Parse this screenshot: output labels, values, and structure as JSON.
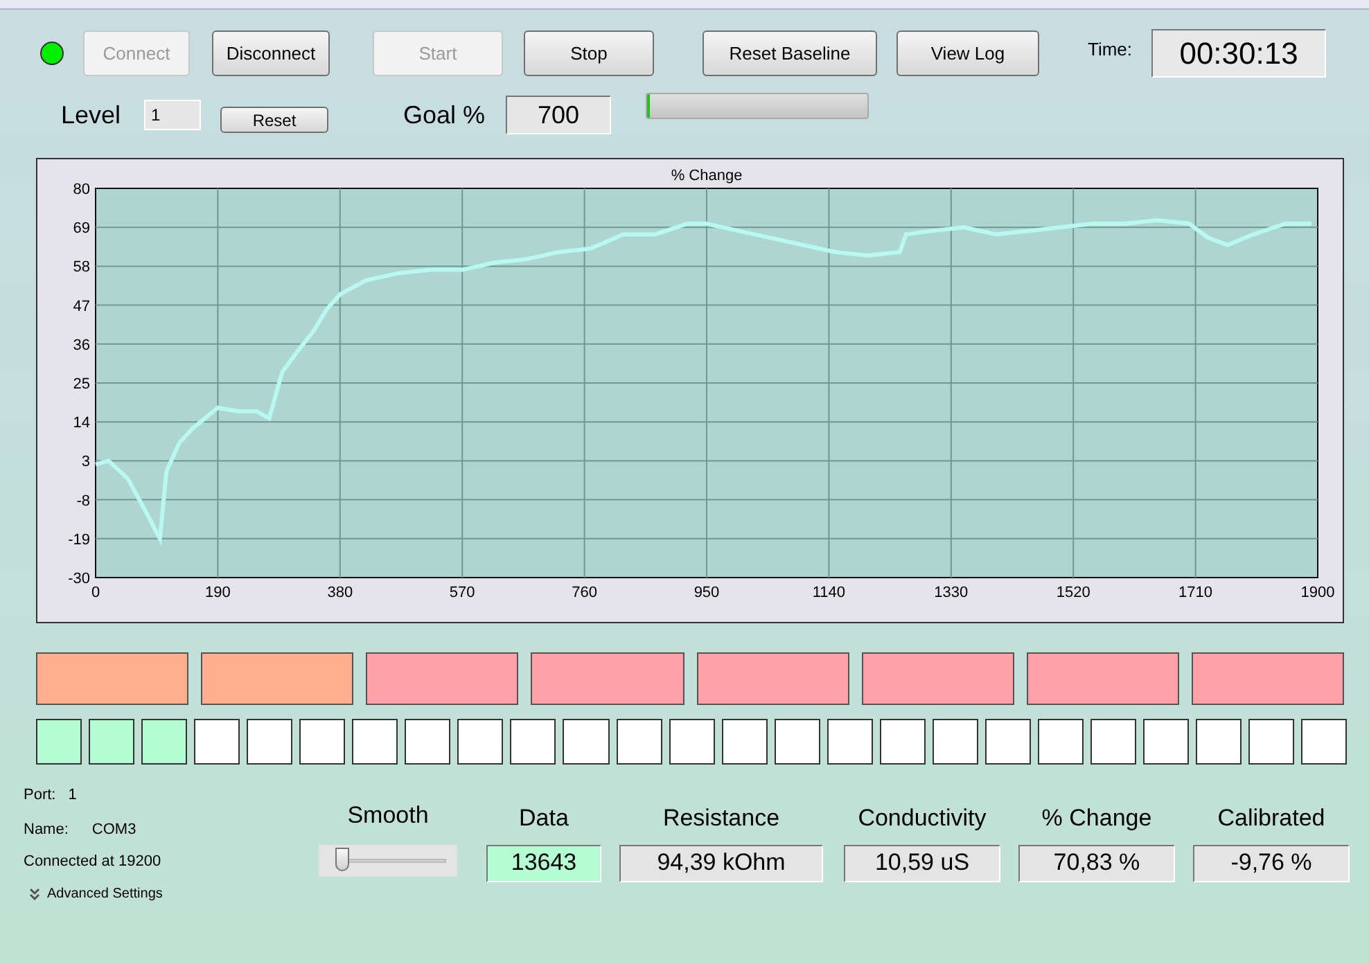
{
  "status": {
    "connected": true
  },
  "toolbar": {
    "buttons": [
      {
        "label": "Connect",
        "disabled": true
      },
      {
        "label": "Disconnect",
        "disabled": false
      },
      {
        "label": "Start",
        "disabled": true
      },
      {
        "label": "Stop",
        "disabled": false
      },
      {
        "label": "Reset Baseline",
        "disabled": false
      },
      {
        "label": "View Log",
        "disabled": false
      }
    ]
  },
  "time": {
    "label": "Time:",
    "value": "00:30:13"
  },
  "level": {
    "label": "Level",
    "value": "1",
    "reset": "Reset"
  },
  "goal": {
    "label": "Goal %",
    "value": "700",
    "progress": {
      "level": 0.01
    }
  },
  "chart": {
    "chart_data": {
      "type": "line",
      "title": "% Change",
      "xlim": [
        0,
        1900
      ],
      "ylim": [
        -30,
        80
      ],
      "xticks": [
        0,
        190,
        380,
        570,
        760,
        950,
        1140,
        1330,
        1520,
        1710,
        1900
      ],
      "yticks": [
        80,
        69,
        58,
        47,
        36,
        25,
        14,
        3,
        -8,
        -19,
        -30
      ],
      "x": [
        0,
        20,
        50,
        80,
        100,
        110,
        130,
        150,
        170,
        190,
        220,
        250,
        270,
        290,
        310,
        340,
        360,
        380,
        420,
        470,
        520,
        570,
        620,
        670,
        720,
        770,
        820,
        870,
        920,
        950,
        1000,
        1050,
        1100,
        1150,
        1200,
        1250,
        1260,
        1300,
        1350,
        1400,
        1450,
        1500,
        1550,
        1600,
        1650,
        1700,
        1730,
        1760,
        1800,
        1850,
        1890
      ],
      "grid": true,
      "series": [
        {
          "color": "#b8f8f0",
          "values": [
            2,
            3,
            -2,
            -12,
            -19,
            0,
            8,
            12,
            15,
            18,
            17,
            17,
            15,
            28,
            33,
            40,
            46,
            50,
            54,
            56,
            57,
            57,
            59,
            60,
            62,
            63,
            67,
            67,
            70,
            70,
            68,
            66,
            64,
            62,
            61,
            62,
            67,
            68,
            69,
            67,
            68,
            69,
            70,
            70,
            71,
            70,
            66,
            64,
            67,
            70,
            70
          ]
        }
      ]
    }
  },
  "stage_blocks": [
    {
      "color": "#ffaf8e"
    },
    {
      "color": "#ffaf8e"
    },
    {
      "color": "#ffa0a8"
    },
    {
      "color": "#ffa0a8"
    },
    {
      "color": "#ffa0a8"
    },
    {
      "color": "#ffa0a8"
    },
    {
      "color": "#ffa0a8"
    },
    {
      "color": "#ffa0a8"
    }
  ],
  "step_squares": [
    {
      "color": "#b4fcd4"
    },
    {
      "color": "#b4fcd4"
    },
    {
      "color": "#b4fcd4"
    },
    {
      "color": "#ffffff"
    },
    {
      "color": "#ffffff"
    },
    {
      "color": "#ffffff"
    },
    {
      "color": "#ffffff"
    },
    {
      "color": "#ffffff"
    },
    {
      "color": "#ffffff"
    },
    {
      "color": "#ffffff"
    },
    {
      "color": "#ffffff"
    },
    {
      "color": "#ffffff"
    },
    {
      "color": "#ffffff"
    },
    {
      "color": "#ffffff"
    },
    {
      "color": "#ffffff"
    },
    {
      "color": "#ffffff"
    },
    {
      "color": "#ffffff"
    },
    {
      "color": "#ffffff"
    },
    {
      "color": "#ffffff"
    },
    {
      "color": "#ffffff"
    },
    {
      "color": "#ffffff"
    },
    {
      "color": "#ffffff"
    },
    {
      "color": "#ffffff"
    },
    {
      "color": "#ffffff"
    },
    {
      "color": "#ffffff"
    }
  ],
  "port_info": {
    "port_label": "Port:",
    "port": "1",
    "name_label": "Name:",
    "name": "COM3",
    "status": "Connected at 19200",
    "advanced": "Advanced Settings"
  },
  "smooth": {
    "label": "Smooth",
    "level": 0.05
  },
  "readouts": [
    {
      "label": "Data",
      "value": "13643",
      "highlighted": true
    },
    {
      "label": "Resistance",
      "value": "94,39 kOhm",
      "highlighted": false
    },
    {
      "label": "Conductivity",
      "value": "10,59 uS",
      "highlighted": false
    },
    {
      "label": "% Change",
      "value": "70,83 %",
      "highlighted": false
    },
    {
      "label": "Calibrated",
      "value": "-9,76 %",
      "highlighted": false
    }
  ]
}
